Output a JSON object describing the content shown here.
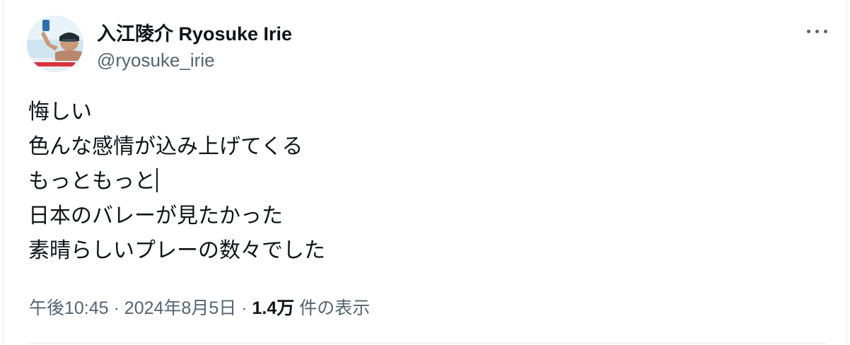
{
  "user": {
    "display_name": "入江陵介 Ryosuke Irie",
    "handle": "@ryosuke_irie"
  },
  "more_icon": "more-horizontal-icon",
  "tweet": {
    "lines": [
      "悔しい",
      "色んな感情が込み上げてくる",
      "もっともっと",
      "日本のバレーが見たかった",
      "素晴らしいプレーの数々でした"
    ]
  },
  "meta": {
    "time": "午後10:45",
    "separator": "·",
    "date": "2024年8月5日",
    "views_count": "1.4万",
    "views_label": "件の表示"
  },
  "colors": {
    "text_primary": "#0f1419",
    "text_secondary": "#536471",
    "border": "#e6ecf0"
  }
}
